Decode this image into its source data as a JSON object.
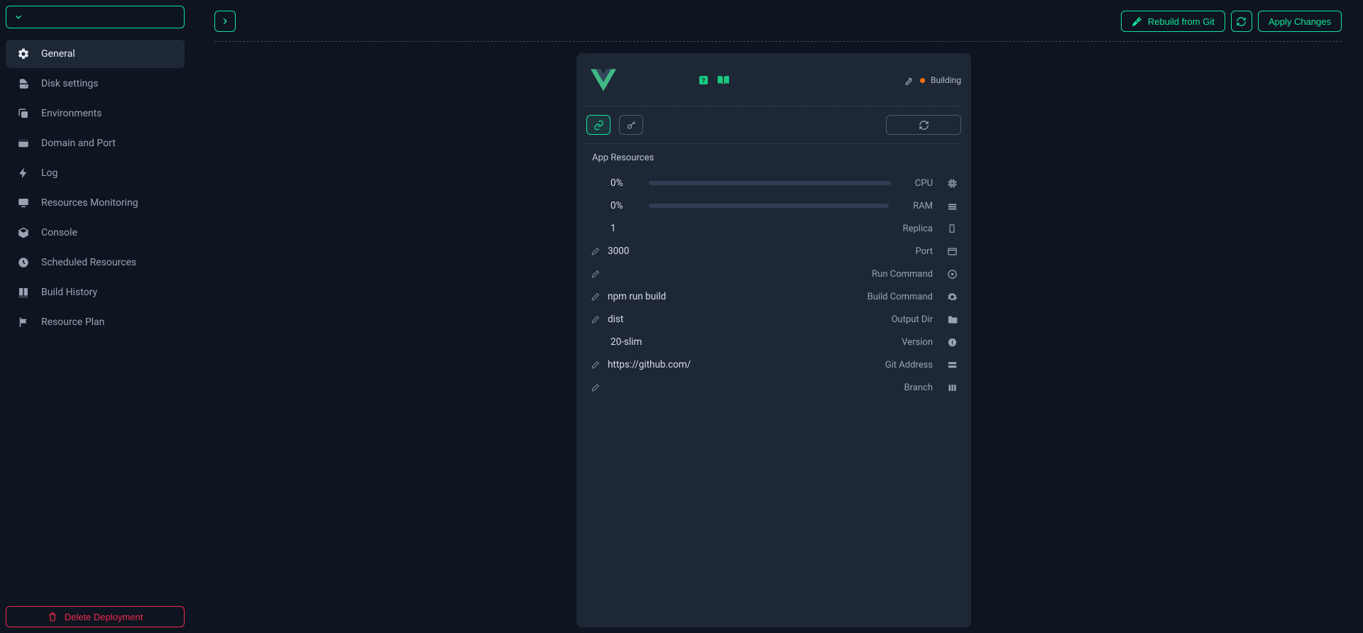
{
  "sidebar": {
    "items": [
      {
        "label": "General"
      },
      {
        "label": "Disk settings"
      },
      {
        "label": "Environments"
      },
      {
        "label": "Domain and Port"
      },
      {
        "label": "Log"
      },
      {
        "label": "Resources Monitoring"
      },
      {
        "label": "Console"
      },
      {
        "label": "Scheduled Resources"
      },
      {
        "label": "Build History"
      },
      {
        "label": "Resource Plan"
      }
    ],
    "delete_label": "Delete Deployment"
  },
  "topbar": {
    "rebuild_label": "Rebuild from Git",
    "apply_label": "Apply Changes"
  },
  "card": {
    "status_label": "Building",
    "section_title": "App Resources",
    "rows": {
      "cpu": {
        "value": "0%",
        "label": "CPU"
      },
      "ram": {
        "value": "0%",
        "label": "RAM"
      },
      "replica": {
        "value": "1",
        "label": "Replica"
      },
      "port": {
        "value": "3000",
        "label": "Port"
      },
      "run": {
        "value": "",
        "label": "Run Command"
      },
      "build": {
        "value": "npm run build",
        "label": "Build Command"
      },
      "out": {
        "value": "dist",
        "label": "Output Dir"
      },
      "ver": {
        "value": "20-slim",
        "label": "Version"
      },
      "git": {
        "value": "https://github.com/",
        "label": "Git Address"
      },
      "branch": {
        "value": "",
        "label": "Branch"
      }
    }
  }
}
